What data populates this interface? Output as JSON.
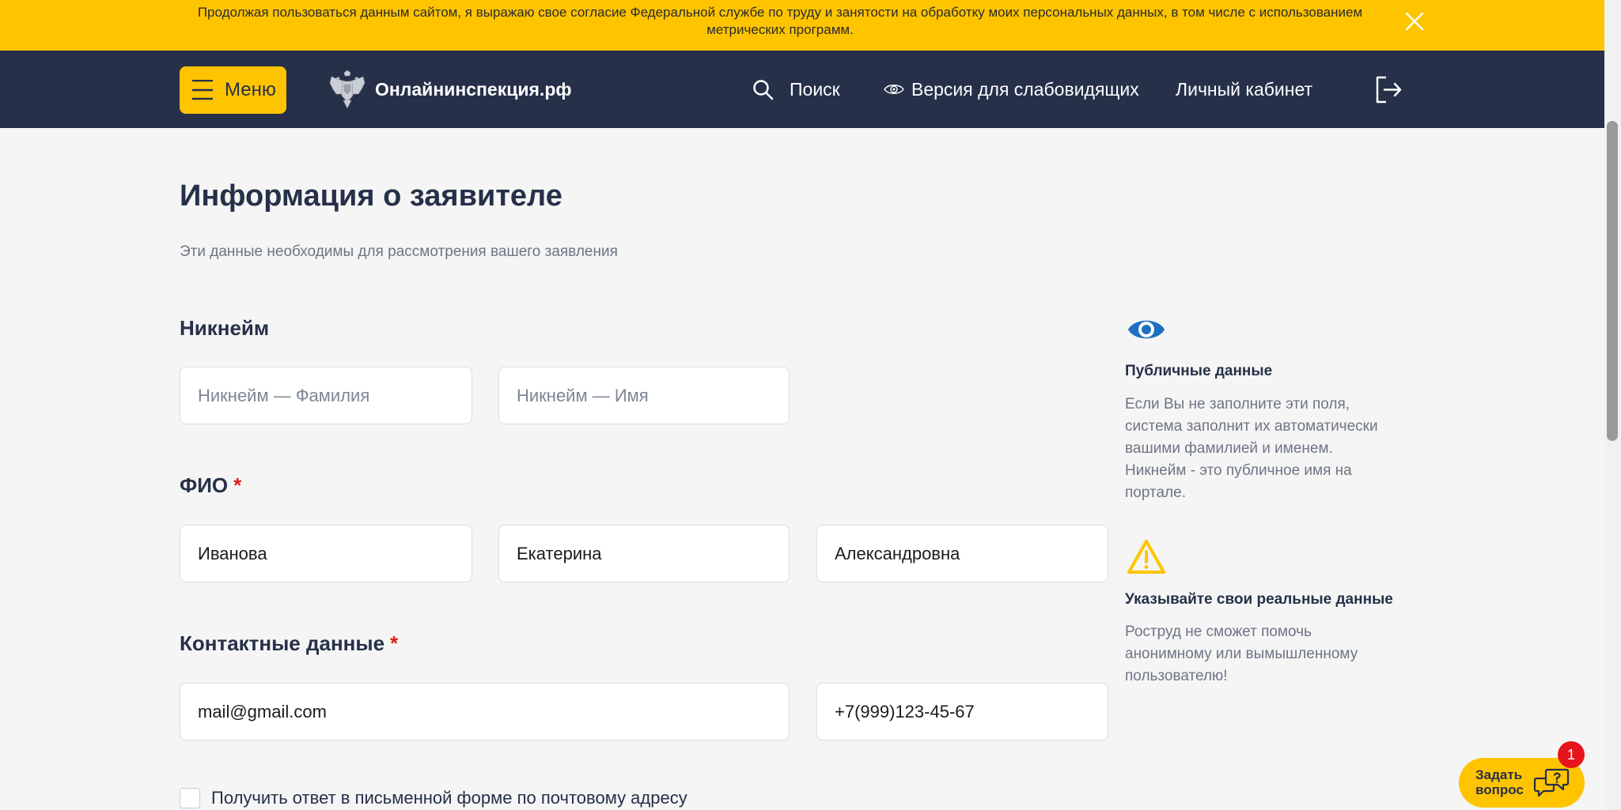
{
  "cookie_banner": {
    "text_line1": "Продолжая пользоваться данным сайтом, я выражаю свое согласие Федеральной службе по труду и занятости на обработку моих персональных данных, в том числе с использованием",
    "text_line2": "метрических программ.",
    "close_icon": "close-icon"
  },
  "header": {
    "menu_icon": "hamburger-icon",
    "menu_label": "Меню",
    "logo_icon": "emblem-icon",
    "site_name": "Онлайнинспекция.рф",
    "search_icon": "search-icon",
    "search_label": "Поиск",
    "low_vision_icon": "eye-icon",
    "low_vision_label": "Версия для слабовидящих",
    "cabinet_label": "Личный кабинет",
    "logout_icon": "logout-icon"
  },
  "main": {
    "title": "Информация о заявителе",
    "subtitle": "Эти данные необходимы для рассмотрения вашего заявления",
    "nickname": {
      "heading": "Никнейм",
      "surname": {
        "placeholder": "Никнейм — Фамилия"
      },
      "name": {
        "placeholder": "Никнейм — Имя"
      }
    },
    "fio": {
      "heading": "ФИО",
      "required_mark": "*",
      "surname": {
        "value": "Иванова"
      },
      "name": {
        "value": "Екатерина"
      },
      "patronymic": {
        "value": "Александровна"
      }
    },
    "contacts": {
      "heading": "Контактные данные",
      "required_mark": "*",
      "email": {
        "value": "mail@gmail.com"
      },
      "phone": {
        "value": "+7(999)123-45-67"
      }
    },
    "postal_answer": {
      "label": "Получить ответ в письменной форме по почтовому адресу",
      "checked": false
    }
  },
  "sidebar": {
    "public_data": {
      "icon": "eye-icon",
      "title": "Публичные данные",
      "text": "Если Вы не заполните эти поля, система заполнит их автоматически вашими фамилией и именем. Никнейм - это публичное имя на портале."
    },
    "real_data": {
      "icon": "warning-icon",
      "title": "Указывайте свои реальные данные",
      "text": "Роструд не сможет помочь анонимному или вымышленному пользователю!"
    }
  },
  "chat_widget": {
    "label_line1": "Задать",
    "label_line2": "вопрос",
    "icon": "chat-icon",
    "badge_count": "1"
  },
  "colors": {
    "accent": "#FFC400",
    "header_bg": "#263049",
    "page_bg": "#F5F5F5",
    "required": "#E0201B",
    "info": "#1E6FC2",
    "badge": "#E8141B"
  }
}
